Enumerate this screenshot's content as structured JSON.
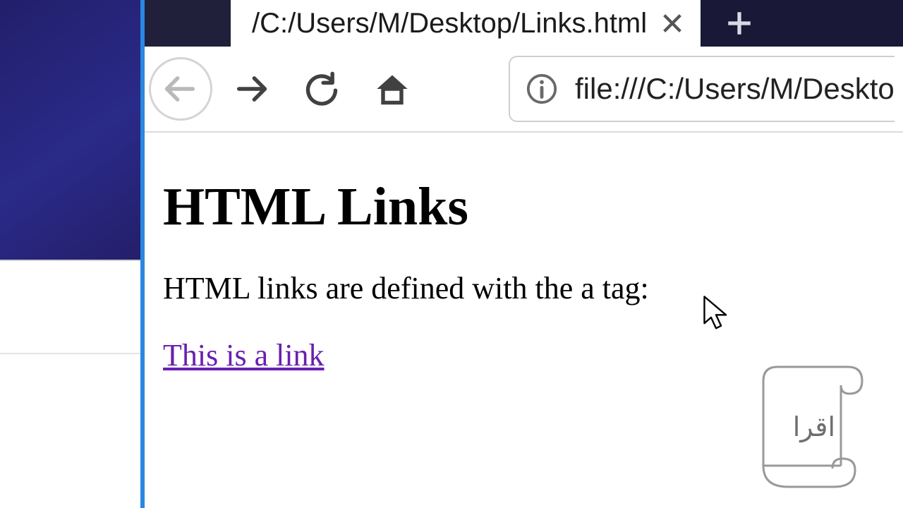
{
  "tabstrip": {
    "tab_title": "/C:/Users/M/Desktop/Links.html"
  },
  "urlbar": {
    "url": "file:///C:/Users/M/Deskto"
  },
  "page": {
    "heading": "HTML Links",
    "paragraph": "HTML links are defined with the a tag:",
    "link_text": "This is a link"
  },
  "watermark": {
    "text": "اقرا"
  }
}
